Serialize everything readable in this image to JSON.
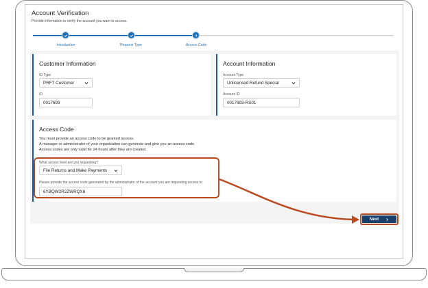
{
  "page": {
    "title": "Account Verification",
    "subtitle": "Provide information to verify the account you want to access."
  },
  "stepper": {
    "steps": [
      {
        "label": "Introduction",
        "state": "complete"
      },
      {
        "label": "Request Type",
        "state": "complete"
      },
      {
        "label": "Access Code",
        "state": "current"
      }
    ]
  },
  "customer": {
    "title": "Customer Information",
    "id_type_label": "ID Type",
    "id_type_value": "PRFT Customer",
    "id_label": "ID",
    "id_value": "0017693"
  },
  "account": {
    "title": "Account Information",
    "type_label": "Account Type",
    "type_value": "Unlicensed Refund Special",
    "id_label": "Account ID",
    "id_value": "0017693-RS01"
  },
  "access": {
    "title": "Access Code",
    "line1": "You must provide an access code to be granted access.",
    "line2": "A manager or administrator of your organization can generate and give you an access code.",
    "line3": "Access codes are only valid for 24 hours after they are created.",
    "level_label": "What access level are you requesting?",
    "level_value": "File Returns and Make Payments",
    "code_label": "Please provide the access code generated by the administrator of the account you are requesting access to",
    "code_value": "6YBQW2R2ZWRQX6"
  },
  "footer": {
    "next_label": "Next",
    "next_icon": "chevron-right-icon"
  },
  "colors": {
    "accent": "#1e6fb8",
    "navy": "#1a3f6b",
    "highlight": "#b84a1f"
  }
}
